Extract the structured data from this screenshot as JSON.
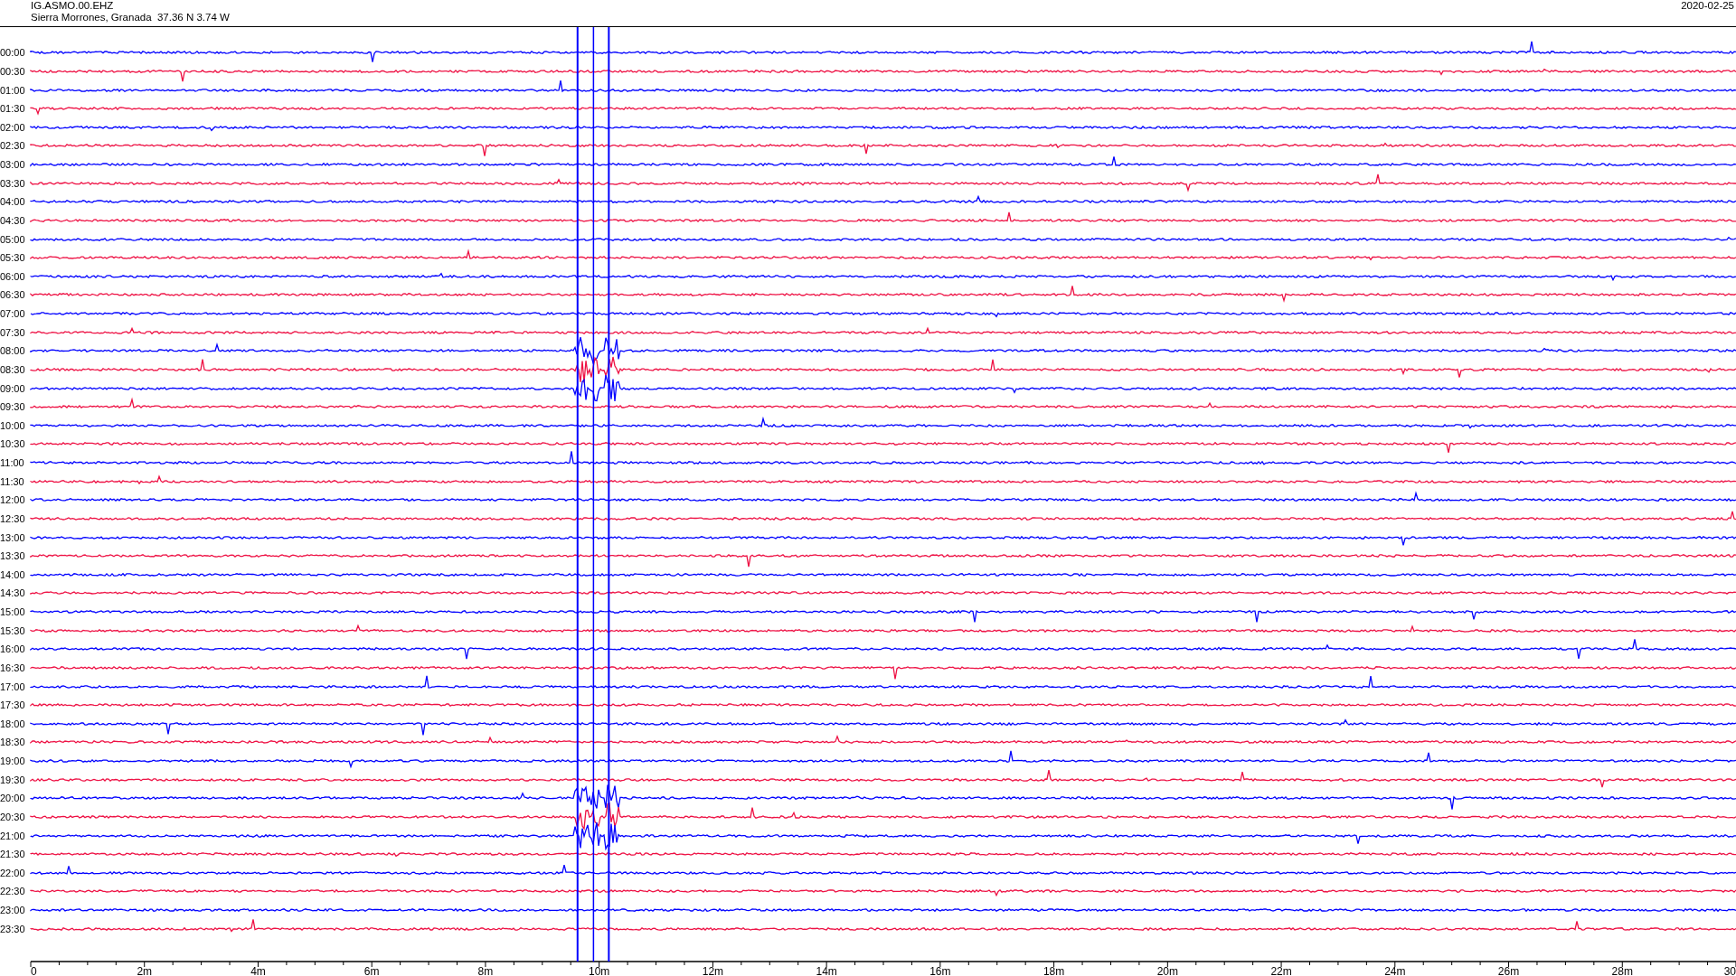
{
  "header": {
    "station": "IG.ASMO.00.EHZ",
    "location": "Sierra Morrones, Granada  37.36 N 3.74 W",
    "date": "2020-02-25"
  },
  "helicorder": {
    "rows": [
      {
        "label": "00:00",
        "color": "#0000ff"
      },
      {
        "label": "00:30",
        "color": "#ee1144"
      },
      {
        "label": "01:00",
        "color": "#0000ff"
      },
      {
        "label": "01:30",
        "color": "#ee1144"
      },
      {
        "label": "02:00",
        "color": "#0000ff"
      },
      {
        "label": "02:30",
        "color": "#ee1144"
      },
      {
        "label": "03:00",
        "color": "#0000ff"
      },
      {
        "label": "03:30",
        "color": "#ee1144"
      },
      {
        "label": "04:00",
        "color": "#0000ff"
      },
      {
        "label": "04:30",
        "color": "#ee1144"
      },
      {
        "label": "05:00",
        "color": "#0000ff"
      },
      {
        "label": "05:30",
        "color": "#ee1144"
      },
      {
        "label": "06:00",
        "color": "#0000ff"
      },
      {
        "label": "06:30",
        "color": "#ee1144"
      },
      {
        "label": "07:00",
        "color": "#0000ff"
      },
      {
        "label": "07:30",
        "color": "#ee1144"
      },
      {
        "label": "08:00",
        "color": "#0000ff"
      },
      {
        "label": "08:30",
        "color": "#ee1144"
      },
      {
        "label": "09:00",
        "color": "#0000ff"
      },
      {
        "label": "09:30",
        "color": "#ee1144"
      },
      {
        "label": "10:00",
        "color": "#0000ff"
      },
      {
        "label": "10:30",
        "color": "#ee1144"
      },
      {
        "label": "11:00",
        "color": "#0000ff"
      },
      {
        "label": "11:30",
        "color": "#ee1144"
      },
      {
        "label": "12:00",
        "color": "#0000ff"
      },
      {
        "label": "12:30",
        "color": "#ee1144"
      },
      {
        "label": "13:00",
        "color": "#0000ff"
      },
      {
        "label": "13:30",
        "color": "#ee1144"
      },
      {
        "label": "14:00",
        "color": "#0000ff"
      },
      {
        "label": "14:30",
        "color": "#ee1144"
      },
      {
        "label": "15:00",
        "color": "#0000ff"
      },
      {
        "label": "15:30",
        "color": "#ee1144"
      },
      {
        "label": "16:00",
        "color": "#0000ff"
      },
      {
        "label": "16:30",
        "color": "#ee1144"
      },
      {
        "label": "17:00",
        "color": "#0000ff"
      },
      {
        "label": "17:30",
        "color": "#ee1144"
      },
      {
        "label": "18:00",
        "color": "#0000ff"
      },
      {
        "label": "18:30",
        "color": "#ee1144"
      },
      {
        "label": "19:00",
        "color": "#0000ff"
      },
      {
        "label": "19:30",
        "color": "#ee1144"
      },
      {
        "label": "20:00",
        "color": "#0000ff"
      },
      {
        "label": "20:30",
        "color": "#ee1144"
      },
      {
        "label": "21:00",
        "color": "#0000ff"
      },
      {
        "label": "21:30",
        "color": "#ee1144"
      },
      {
        "label": "22:00",
        "color": "#0000ff"
      },
      {
        "label": "22:30",
        "color": "#ee1144"
      },
      {
        "label": "23:00",
        "color": "#0000ff"
      },
      {
        "label": "23:30",
        "color": "#ee1144"
      }
    ],
    "x_axis": {
      "ticks": [
        "0",
        "2m",
        "4m",
        "6m",
        "8m",
        "10m",
        "12m",
        "14m",
        "16m",
        "18m",
        "20m",
        "22m",
        "24m",
        "26m",
        "28m",
        "30"
      ]
    }
  }
}
